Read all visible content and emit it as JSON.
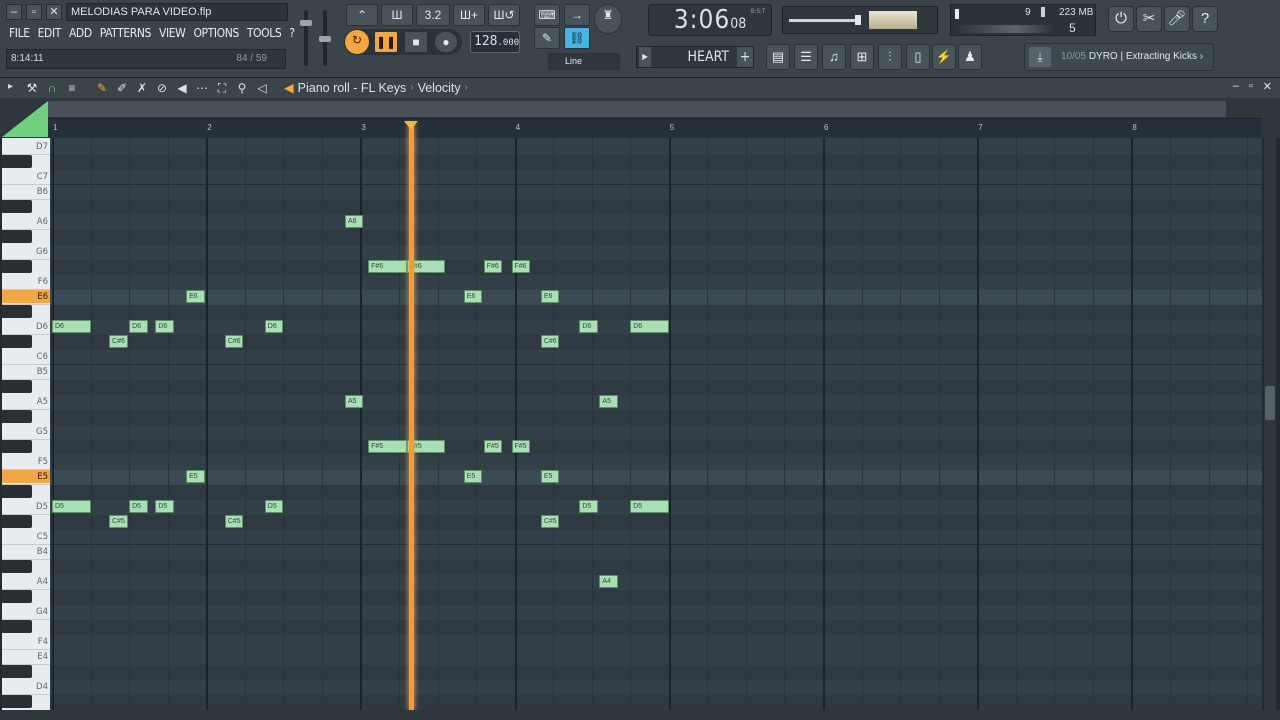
{
  "window": {
    "project_title": "MELODIAS PARA VIDEO.flp",
    "menu": [
      "FILE",
      "EDIT",
      "ADD",
      "PATTERNS",
      "VIEW",
      "OPTIONS",
      "TOOLS",
      "?"
    ],
    "hint_left": "8:14:11",
    "hint_right": "84 / 59"
  },
  "transport": {
    "time_main": "3:06",
    "time_sub": "08",
    "time_unit": "B:S:T",
    "tempo_int": "128",
    "tempo_dec": ".000",
    "snap_label": "Line",
    "mode_display": "3.2"
  },
  "cpu": {
    "memory": "223 MB",
    "cpu_top": "9",
    "cpu_bottom": "5"
  },
  "pattern": {
    "name": "HEART",
    "plus": "+"
  },
  "news": {
    "count": "10/05",
    "text": "DYRO | Extracting Kicks"
  },
  "piano_roll": {
    "breadcrumb": [
      "Piano roll - FL Keys",
      "Velocity"
    ],
    "bar_numbers": [
      "1",
      "2",
      "3",
      "4",
      "5",
      "6",
      "7",
      "8"
    ]
  },
  "keyboard_labels": [
    {
      "key": "D7",
      "row": 1
    },
    {
      "key": "C7",
      "row": 3
    },
    {
      "key": "B6",
      "row": 4
    },
    {
      "key": "A6",
      "row": 6
    },
    {
      "key": "G6",
      "row": 8
    },
    {
      "key": "F6",
      "row": 10
    },
    {
      "key": "E6",
      "row": 11
    },
    {
      "key": "D6",
      "row": 13
    },
    {
      "key": "C6",
      "row": 15
    },
    {
      "key": "B5",
      "row": 16
    },
    {
      "key": "A5",
      "row": 18
    },
    {
      "key": "G5",
      "row": 20
    },
    {
      "key": "F5",
      "row": 22
    },
    {
      "key": "E5",
      "row": 23
    },
    {
      "key": "D5",
      "row": 25
    },
    {
      "key": "C5",
      "row": 27
    },
    {
      "key": "B4",
      "row": 28
    },
    {
      "key": "A4",
      "row": 30
    },
    {
      "key": "G4",
      "row": 32
    },
    {
      "key": "F4",
      "row": 34
    },
    {
      "key": "E4",
      "row": 35
    },
    {
      "key": "D4",
      "row": 37
    }
  ],
  "notes": [
    {
      "label": "A6",
      "row": 6,
      "start": 2.9,
      "len": 0.12
    },
    {
      "label": "F#6",
      "row": 9,
      "start": 3.05,
      "len": 0.25
    },
    {
      "label": "F#6",
      "row": 9,
      "start": 3.3,
      "len": 0.25
    },
    {
      "label": "F#6",
      "row": 9,
      "start": 3.8,
      "len": 0.12
    },
    {
      "label": "F#6",
      "row": 9,
      "start": 3.98,
      "len": 0.12
    },
    {
      "label": "E6",
      "row": 11,
      "start": 1.87,
      "len": 0.12
    },
    {
      "label": "E6",
      "row": 11,
      "start": 3.67,
      "len": 0.12
    },
    {
      "label": "E6",
      "row": 11,
      "start": 4.17,
      "len": 0.12
    },
    {
      "label": "D6",
      "row": 13,
      "start": 1.0,
      "len": 0.25
    },
    {
      "label": "D6",
      "row": 13,
      "start": 1.5,
      "len": 0.12
    },
    {
      "label": "D6",
      "row": 13,
      "start": 1.67,
      "len": 0.12
    },
    {
      "label": "D6",
      "row": 13,
      "start": 2.38,
      "len": 0.12
    },
    {
      "label": "D6",
      "row": 13,
      "start": 4.42,
      "len": 0.12
    },
    {
      "label": "D6",
      "row": 13,
      "start": 4.75,
      "len": 0.25
    },
    {
      "label": "C#6",
      "row": 14,
      "start": 1.37,
      "len": 0.12
    },
    {
      "label": "C#6",
      "row": 14,
      "start": 2.12,
      "len": 0.12
    },
    {
      "label": "C#6",
      "row": 14,
      "start": 4.17,
      "len": 0.12
    },
    {
      "label": "A5",
      "row": 18,
      "start": 2.9,
      "len": 0.12
    },
    {
      "label": "A5",
      "row": 18,
      "start": 4.55,
      "len": 0.12
    },
    {
      "label": "F#5",
      "row": 21,
      "start": 3.05,
      "len": 0.25
    },
    {
      "label": "F#5",
      "row": 21,
      "start": 3.3,
      "len": 0.25
    },
    {
      "label": "F#5",
      "row": 21,
      "start": 3.8,
      "len": 0.12
    },
    {
      "label": "F#5",
      "row": 21,
      "start": 3.98,
      "len": 0.12
    },
    {
      "label": "E5",
      "row": 23,
      "start": 1.87,
      "len": 0.12
    },
    {
      "label": "E5",
      "row": 23,
      "start": 3.67,
      "len": 0.12
    },
    {
      "label": "E5",
      "row": 23,
      "start": 4.17,
      "len": 0.12
    },
    {
      "label": "D5",
      "row": 25,
      "start": 1.0,
      "len": 0.25
    },
    {
      "label": "D5",
      "row": 25,
      "start": 1.5,
      "len": 0.12
    },
    {
      "label": "D5",
      "row": 25,
      "start": 1.67,
      "len": 0.12
    },
    {
      "label": "D5",
      "row": 25,
      "start": 2.38,
      "len": 0.12
    },
    {
      "label": "D5",
      "row": 25,
      "start": 4.42,
      "len": 0.12
    },
    {
      "label": "D5",
      "row": 25,
      "start": 4.75,
      "len": 0.25
    },
    {
      "label": "C#5",
      "row": 26,
      "start": 1.37,
      "len": 0.12
    },
    {
      "label": "C#5",
      "row": 26,
      "start": 2.12,
      "len": 0.12
    },
    {
      "label": "C#5",
      "row": 26,
      "start": 4.17,
      "len": 0.12
    },
    {
      "label": "A4",
      "row": 30,
      "start": 4.55,
      "len": 0.12
    }
  ],
  "highlight_keys": [
    "E6",
    "E5"
  ],
  "playhead_position": 3.33,
  "colors": {
    "accent": "#f29b3a",
    "note_fill": "#a9dfb5",
    "background": "#344049"
  }
}
